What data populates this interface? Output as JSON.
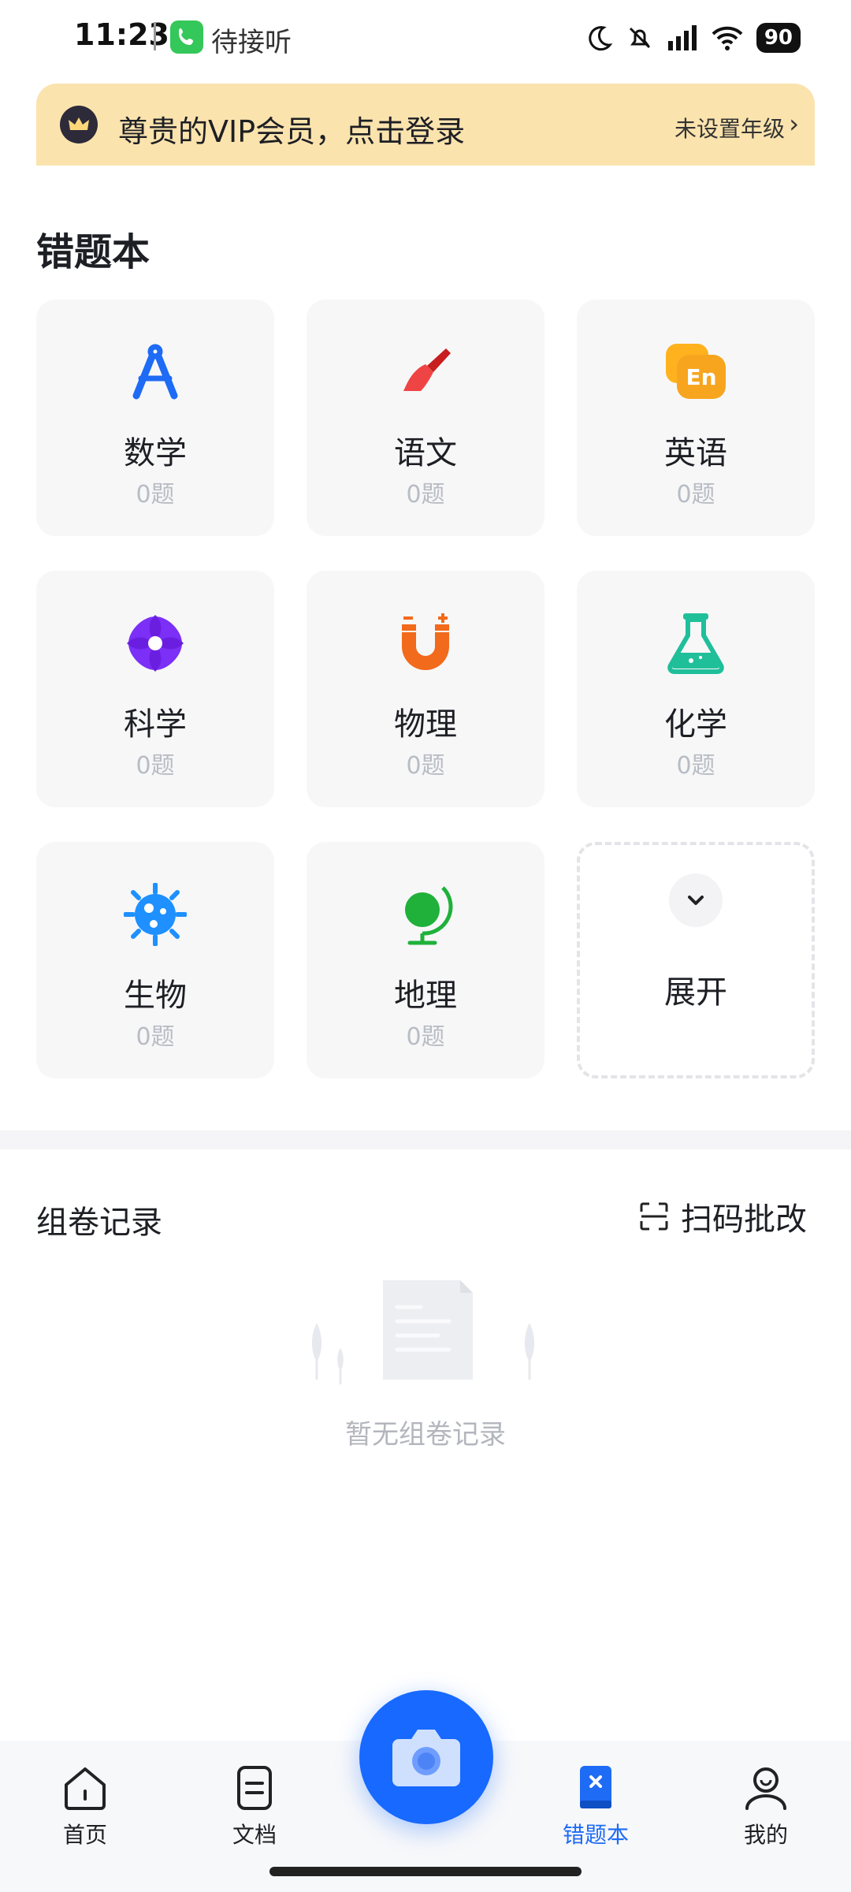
{
  "status_bar": {
    "time": "11:23",
    "call_text": "待接听",
    "battery": "90"
  },
  "vip_banner": {
    "title": "尊贵的VIP会员，点击登录",
    "grade": "未设置年级",
    "chevron": "›"
  },
  "wrongbook": {
    "title": "错题本",
    "subjects": [
      {
        "name": "数学",
        "count": "0题",
        "icon": "compass-icon",
        "color": "#1e6bf5"
      },
      {
        "name": "语文",
        "count": "0题",
        "icon": "brush-icon",
        "color": "#ef4444"
      },
      {
        "name": "英语",
        "count": "0题",
        "icon": "english-bubble-icon",
        "color": "#f7a51e"
      },
      {
        "name": "科学",
        "count": "0题",
        "icon": "atom-icon",
        "color": "#7b2ff7"
      },
      {
        "name": "物理",
        "count": "0题",
        "icon": "magnet-icon",
        "color": "#f26a1b"
      },
      {
        "name": "化学",
        "count": "0题",
        "icon": "flask-icon",
        "color": "#1fbf9a"
      },
      {
        "name": "生物",
        "count": "0题",
        "icon": "microbe-icon",
        "color": "#1e90ff"
      },
      {
        "name": "地理",
        "count": "0题",
        "icon": "globe-icon",
        "color": "#1fb13a"
      }
    ],
    "expand_label": "展开"
  },
  "records": {
    "title": "组卷记录",
    "scan_label": "扫码批改",
    "empty_text": "暂无组卷记录"
  },
  "bottom_nav": {
    "items": [
      {
        "label": "首页",
        "icon": "home-icon"
      },
      {
        "label": "文档",
        "icon": "document-icon"
      },
      {
        "label": "错题本",
        "icon": "wrongbook-icon",
        "active": true
      },
      {
        "label": "我的",
        "icon": "profile-icon"
      }
    ],
    "camera_icon": "camera-icon",
    "active_color": "#1e6bf5"
  }
}
